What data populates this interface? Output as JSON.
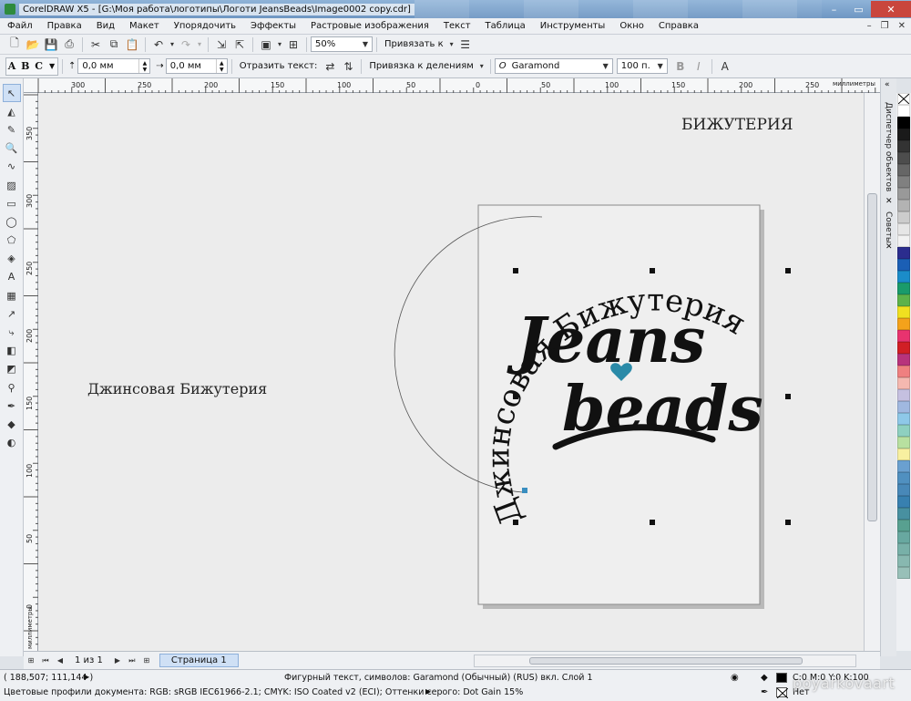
{
  "window": {
    "title": "CorelDRAW X5 - [G:\\Моя работа\\логотипы\\Логоти JeansBeads\\Image0002 copy.cdr]",
    "controls": [
      "–",
      "▭",
      "✕"
    ]
  },
  "menu": {
    "items": [
      "Файл",
      "Правка",
      "Вид",
      "Макет",
      "Упорядочить",
      "Эффекты",
      "Растровые изображения",
      "Текст",
      "Таблица",
      "Инструменты",
      "Окно",
      "Справка"
    ]
  },
  "toolbar": {
    "zoom": "50%",
    "snap_label": "Привязать к"
  },
  "property_bar": {
    "abc_label": "A B C",
    "offset_x": "0,0 мм",
    "offset_y": "0,0 мм",
    "mirror_label": "Отразить текст:",
    "snap_divisions": "Привязка к делениям",
    "font_name": "Garamond",
    "font_size": "100 п."
  },
  "ruler": {
    "top_ticks": [
      "300",
      "250",
      "200",
      "150",
      "100",
      "50",
      "0",
      "50",
      "100",
      "150",
      "200",
      "250"
    ],
    "units": "миллиметры",
    "left_ticks": [
      "350",
      "300",
      "250",
      "200",
      "150",
      "100",
      "50",
      "0"
    ],
    "left_units": "миллиметры"
  },
  "canvas": {
    "text_top_right": "БИЖУТЕРИЯ",
    "text_left": "Джинсовая Бижутерия",
    "logo_line1": "Jeans",
    "logo_line2": "beads",
    "curved_text": "Джинсовая Бижутерия",
    "accent_color": "#2a8aa8"
  },
  "pages": {
    "counter": "1 из 1",
    "tab": "Страница 1"
  },
  "docker": {
    "tab1": "Диспетчер объектов",
    "tab2": "Советы"
  },
  "palette": [
    "#ffffff",
    "#000000",
    "#1a1a1a",
    "#333333",
    "#4d4d4d",
    "#666666",
    "#808080",
    "#999999",
    "#b3b3b3",
    "#cccccc",
    "#e6e6e6",
    "#f2f2f2",
    "#2b2d8e",
    "#1b5fb5",
    "#1b8cc9",
    "#1a9b6b",
    "#5db24a",
    "#f0e020",
    "#f4a21b",
    "#e8336f",
    "#d11f25",
    "#b8337c",
    "#ef8080",
    "#f5b8b0",
    "#c5c0e0",
    "#a0b8e0",
    "#8ec8e8",
    "#8ed0c0",
    "#b8e0a0",
    "#f8f0a0",
    "#6aa0d0",
    "#5090c0",
    "#4888b8",
    "#3880b0",
    "#4890a0",
    "#58a090",
    "#68a8a0",
    "#78b0a8",
    "#88b8b0",
    "#98c0b8"
  ],
  "status": {
    "coords": "( 188,507; 111,144 )",
    "object_info": "Фигурный текст, символов: Garamond (Обычный) (RUS) вкл. Слой 1",
    "color_profiles": "Цветовые профили документа: RGB: sRGB IEC61966-2.1; CMYK: ISO Coated v2 (ECI); Оттенки серого: Dot Gain 15%",
    "fill_value": "C:0 M:0 Y:0 K:100",
    "outline_value": "Нет"
  },
  "watermark": "poyarkovaart"
}
